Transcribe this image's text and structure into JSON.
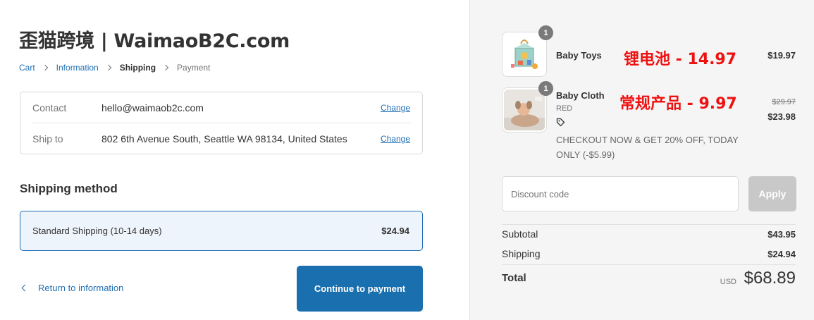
{
  "store": {
    "title": "歪猫跨境 | WaimaoB2C.com"
  },
  "breadcrumb": {
    "cart": "Cart",
    "information": "Information",
    "shipping": "Shipping",
    "payment": "Payment"
  },
  "review": {
    "contact_label": "Contact",
    "contact_value": "hello@waimaob2c.com",
    "contact_change": "Change",
    "shipto_label": "Ship to",
    "shipto_value": "802 6th Avenue South, Seattle WA 98134, United States",
    "shipto_change": "Change"
  },
  "shipping_method": {
    "title": "Shipping method",
    "option_name": "Standard Shipping (10-14 days)",
    "option_price": "$24.94"
  },
  "actions": {
    "return_label": "Return to information",
    "continue_label": "Continue to payment"
  },
  "cart": {
    "items": [
      {
        "name": "Baby Toys",
        "quantity": "1",
        "price": "$19.97",
        "annotation": "锂电池 - 14.97"
      },
      {
        "name": "Baby Cloth",
        "variant": "RED",
        "quantity": "1",
        "original_price": "$29.97",
        "price": "$23.98",
        "annotation": "常规产品 - 9.97",
        "promo": "CHECKOUT NOW & GET 20% OFF, TODAY ONLY (-$5.99)"
      }
    ]
  },
  "discount": {
    "placeholder": "Discount code",
    "apply_label": "Apply"
  },
  "summary": {
    "subtotal_label": "Subtotal",
    "subtotal_value": "$43.95",
    "shipping_label": "Shipping",
    "shipping_value": "$24.94",
    "total_label": "Total",
    "currency": "USD",
    "total_value": "$68.89"
  },
  "colors": {
    "accent": "#1a6fae",
    "link": "#1f6fb5",
    "annotation": "#ee1111",
    "sidebar_bg": "#f5f5f5"
  }
}
